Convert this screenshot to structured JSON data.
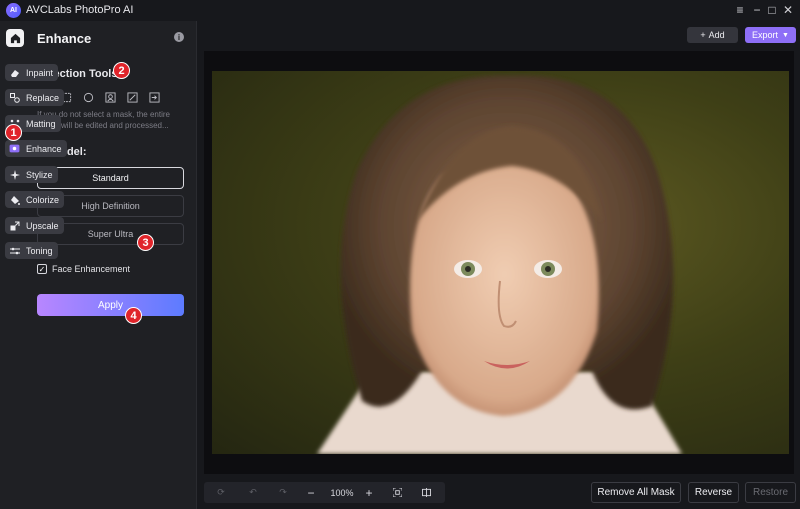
{
  "app": {
    "logo_text": "AI",
    "title": "AVCLabs PhotoPro AI"
  },
  "window_controls": {
    "menu": "≡",
    "minimize": "−",
    "maximize": "□",
    "close": "✕"
  },
  "panel": {
    "title": "Enhance",
    "selection_tools_label": "Selection Tools:",
    "selection_note": "If you do not select a mask, the entire image will be edited and processed...",
    "ai_model_label": "AI Model:",
    "model_options": [
      "Standard",
      "High Definition",
      "Super Ultra"
    ],
    "selected_model": "Standard",
    "face_enhancement_label": "Face Enhancement",
    "face_enhancement_checked": true,
    "apply_label": "Apply"
  },
  "nav": {
    "items": [
      {
        "label": "Inpaint",
        "icon": "eraser-icon"
      },
      {
        "label": "Replace",
        "icon": "replace-icon"
      },
      {
        "label": "Matting",
        "icon": "matting-icon"
      },
      {
        "label": "Enhance",
        "icon": "enhance-icon"
      },
      {
        "label": "Stylize",
        "icon": "stylize-icon"
      },
      {
        "label": "Colorize",
        "icon": "colorize-icon"
      },
      {
        "label": "Upscale",
        "icon": "upscale-icon"
      },
      {
        "label": "Toning",
        "icon": "toning-icon"
      }
    ],
    "active": "Enhance"
  },
  "badges": [
    "1",
    "2",
    "3",
    "4"
  ],
  "header": {
    "add_label": "Add",
    "export_label": "Export"
  },
  "zoom": {
    "level": "100%"
  },
  "actions": {
    "remove_all_mask": "Remove All Mask",
    "reverse": "Reverse",
    "restore": "Restore"
  },
  "colors": {
    "accent": "#8e6ff7",
    "apply_gradient_start": "#b886ff",
    "apply_gradient_end": "#5d7bff",
    "badge": "#e0242a"
  }
}
